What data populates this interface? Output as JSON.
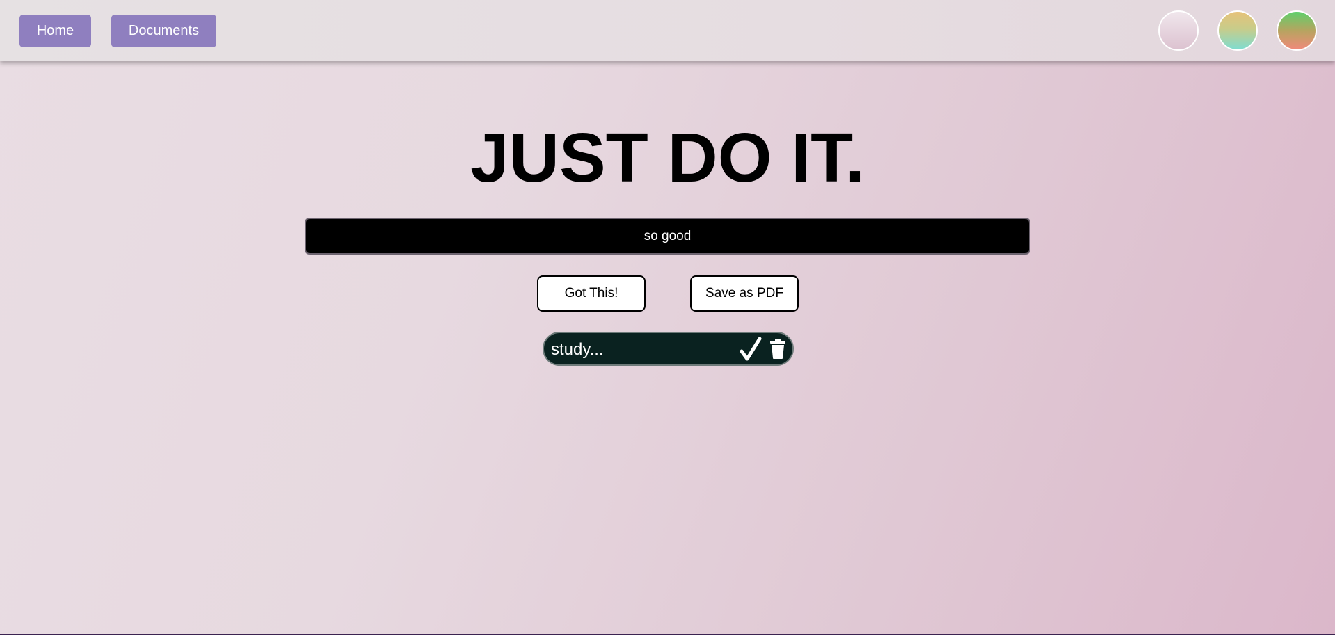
{
  "nav": {
    "home_label": "Home",
    "documents_label": "Documents"
  },
  "themes": [
    {
      "name": "theme-pink",
      "colors": [
        "#e8dce4",
        "#d9b8c9"
      ]
    },
    {
      "name": "theme-gold-teal",
      "colors": [
        "#e6c27a",
        "#7fdcd0"
      ]
    },
    {
      "name": "theme-green-coral",
      "colors": [
        "#5fcf6b",
        "#f08a7a"
      ]
    }
  ],
  "headline": "JUST DO IT.",
  "task_input": {
    "value": "so good",
    "placeholder": ""
  },
  "actions": {
    "add_label": "Got This!",
    "pdf_label": "Save as PDF"
  },
  "todos": [
    {
      "text": "study...",
      "check_icon": "checkmark-icon",
      "delete_icon": "trash-icon"
    }
  ],
  "colors": {
    "accent": "#8f7fbf",
    "todo_bg": "#0a2220",
    "input_bg": "#000000"
  }
}
